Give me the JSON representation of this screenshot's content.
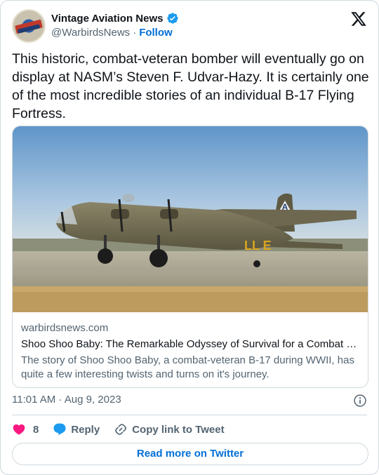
{
  "author": {
    "name": "Vintage Aviation News",
    "handle": "@WarbirdsNews",
    "separator": "·",
    "follow_label": "Follow",
    "avatar_text": "Vintage Aviation News"
  },
  "tweet": {
    "text": "This historic, combat-veteran bomber will eventually go on display at NASM’s Steven F. Udvar-Hazy. It is certainly one of the most incredible stories of an individual B-17 Flying Fortress."
  },
  "card": {
    "domain": "warbirdsnews.com",
    "title": "Shoo Shoo Baby: The Remarkable Odyssey of Survival for a Combat V…",
    "description": "The story of Shoo Shoo Baby, a combat-veteran B-17 during WWII, has quite a few interesting twists and turns on it's journey.",
    "image_alt": "B-17 Flying Fortress on runway",
    "tail_letter": "A",
    "fuselage_marking": "LL E"
  },
  "meta": {
    "timestamp": "11:01 AM · Aug 9, 2023"
  },
  "actions": {
    "like_count": "8",
    "reply_label": "Reply",
    "copy_label": "Copy link to Tweet"
  },
  "footer": {
    "read_more_label": "Read more on Twitter"
  },
  "colors": {
    "accent": "#006fd6",
    "like": "#f91880",
    "reply": "#1d9bf0",
    "verified": "#1d9bf0",
    "muted": "#536471",
    "border": "#cfd9de"
  }
}
